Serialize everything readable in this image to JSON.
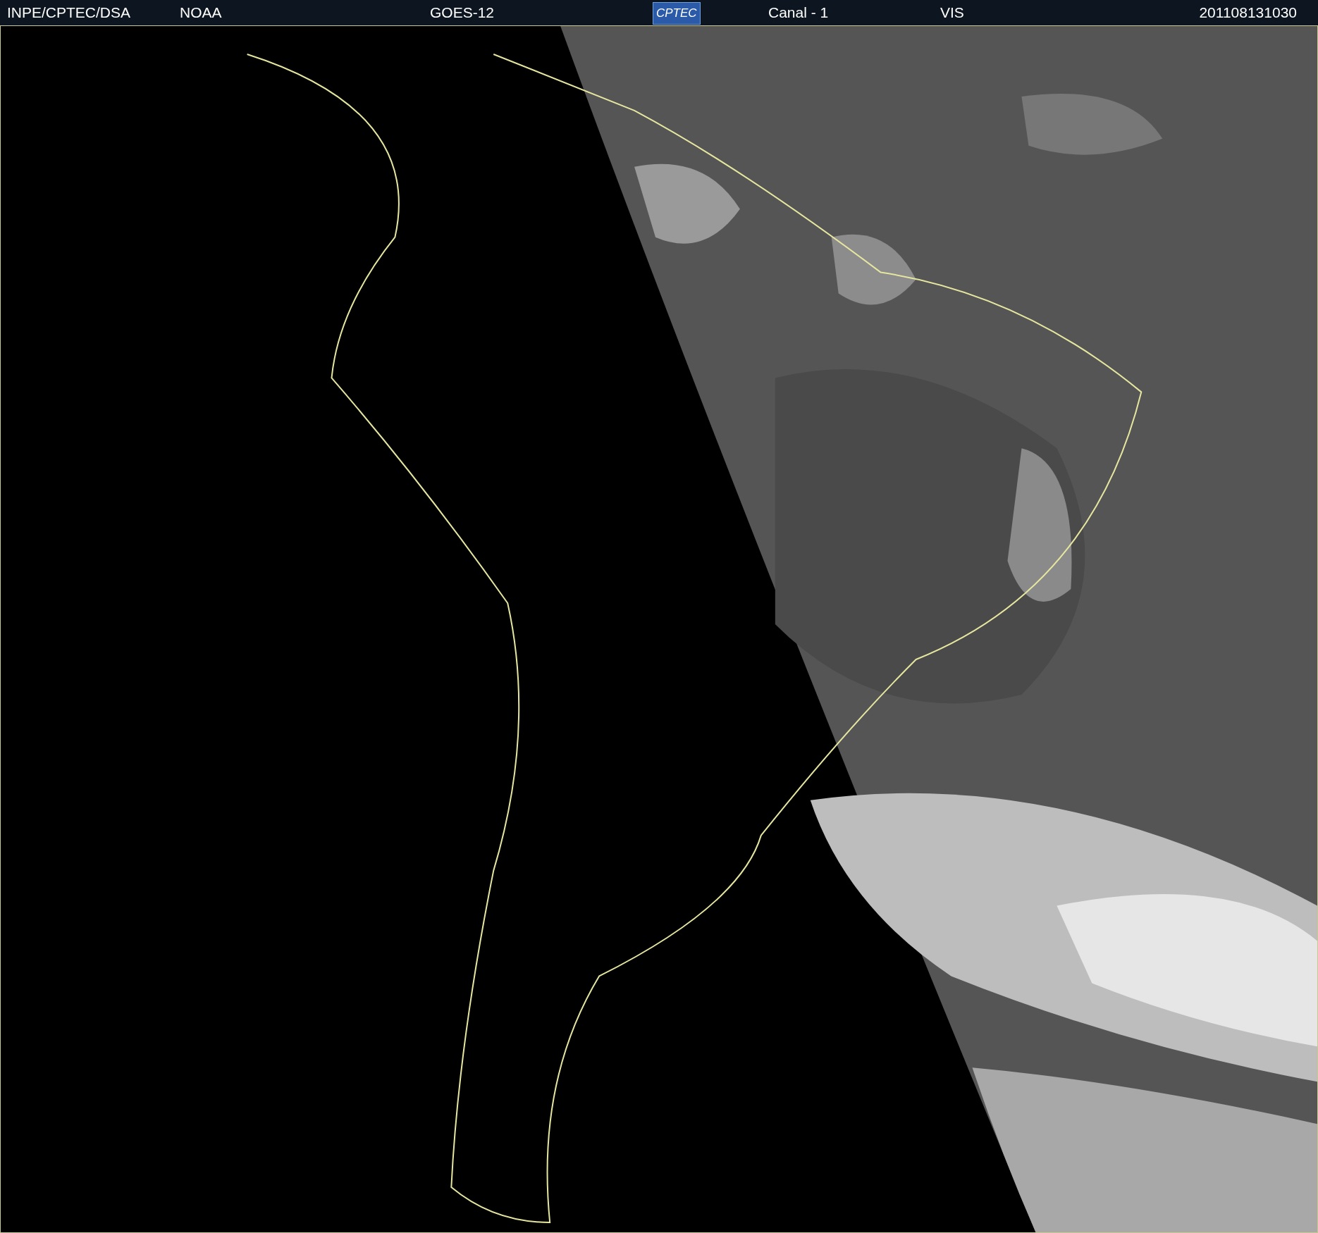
{
  "header": {
    "left_items": [
      "INPE/CPTEC/DSA",
      "NOAA",
      "GOES-12"
    ],
    "logo": "CPTEC",
    "right_items": [
      "Canal - 1",
      "VIS",
      "201108131030"
    ]
  }
}
